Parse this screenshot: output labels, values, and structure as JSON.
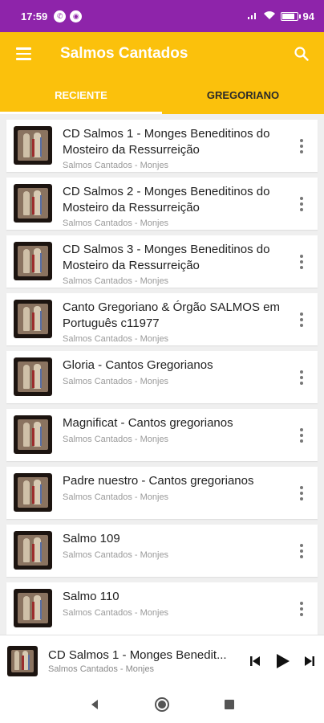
{
  "status_bar": {
    "time": "17:59",
    "battery": "94"
  },
  "app_bar": {
    "title": "Salmos Cantados"
  },
  "tabs": [
    {
      "label": "RECIENTE",
      "active": true
    },
    {
      "label": "GREGORIANO",
      "active": false
    }
  ],
  "items": [
    {
      "title": "CD Salmos 1 - Monges Beneditinos do Mosteiro da Ressurreição",
      "subtitle": "Salmos Cantados - Monjes"
    },
    {
      "title": "CD Salmos 2 - Monges Beneditinos do Mosteiro da Ressurreição",
      "subtitle": "Salmos Cantados - Monjes"
    },
    {
      "title": "CD Salmos 3 - Monges Beneditinos do Mosteiro da Ressurreição",
      "subtitle": "Salmos Cantados - Monjes"
    },
    {
      "title": "Canto Gregoriano & Órgão SALMOS em Português c11977",
      "subtitle": "Salmos Cantados - Monjes"
    },
    {
      "title": "Gloria - Cantos Gregorianos",
      "subtitle": "Salmos Cantados - Monjes"
    },
    {
      "title": "Magnificat - Cantos gregorianos",
      "subtitle": "Salmos Cantados - Monjes"
    },
    {
      "title": "Padre nuestro - Cantos gregorianos",
      "subtitle": "Salmos Cantados - Monjes"
    },
    {
      "title": "Salmo 109",
      "subtitle": "Salmos Cantados - Monjes"
    },
    {
      "title": "Salmo 110",
      "subtitle": "Salmos Cantados - Monjes"
    }
  ],
  "player": {
    "title": "CD Salmos 1 - Monges Benedit...",
    "subtitle": "Salmos Cantados - Monjes"
  },
  "colors": {
    "status_bar": "#8e24aa",
    "accent": "#fbc10c",
    "list_bg": "#efefef"
  },
  "icons": {
    "menu": "hamburger-menu-icon",
    "search": "search-icon",
    "more": "more-vertical-icon",
    "prev": "skip-previous-icon",
    "play": "play-icon",
    "next": "skip-next-icon"
  }
}
